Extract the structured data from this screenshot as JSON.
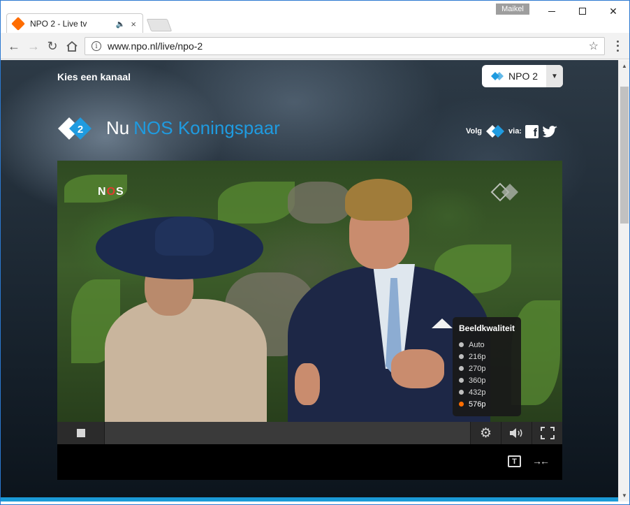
{
  "browser": {
    "tab_title": "NPO 2 - Live tv",
    "tab_audio_icon": "speaker-icon",
    "tab_close": "×",
    "user_name": "Maikel",
    "url": "www.npo.nl/live/npo-2"
  },
  "page": {
    "channel_prompt": "Kies een kanaal",
    "channel_selected": "NPO 2",
    "now_prefix": "Nu",
    "now_show": "NOS Koningspaar",
    "follow_label": "Volg",
    "follow_via": "via:",
    "brand_color": "#1f9be0",
    "accent_color": "#ff6d00"
  },
  "video": {
    "broadcaster_bug": "NOS",
    "broadcaster_bug_parts": [
      "N",
      "O",
      "S"
    ]
  },
  "quality_menu": {
    "title": "Beeldkwaliteit",
    "options": [
      {
        "label": "Auto",
        "selected": false
      },
      {
        "label": "216p",
        "selected": false
      },
      {
        "label": "270p",
        "selected": false
      },
      {
        "label": "360p",
        "selected": false
      },
      {
        "label": "432p",
        "selected": false
      },
      {
        "label": "576p",
        "selected": true
      }
    ]
  },
  "controls": {
    "subtitle_label": "T",
    "collapse_label": "→←"
  }
}
